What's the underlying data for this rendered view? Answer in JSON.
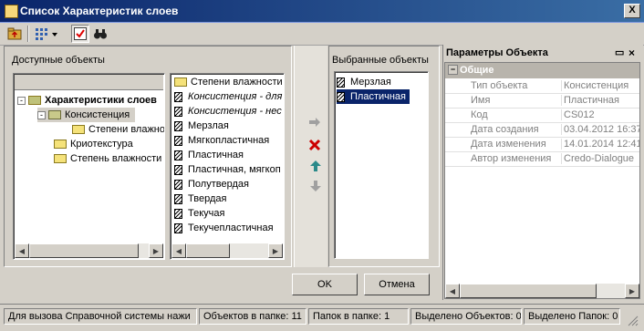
{
  "window": {
    "title": "Список Характеристик слоев",
    "close_label": "X"
  },
  "toolbar": {
    "buttons": [
      "folder-up-icon",
      "view-tree-icon",
      "check-icon",
      "find-icon"
    ]
  },
  "left": {
    "label": "Доступные объекты",
    "tree": [
      {
        "label": "Характеристики слоев",
        "level": 0,
        "bold": true,
        "expander": "-"
      },
      {
        "label": "Консистенция",
        "level": 1,
        "expander": "-"
      },
      {
        "label": "Степени влажнос",
        "level": 2
      },
      {
        "label": "Криотекстура",
        "level": 1
      },
      {
        "label": "Степень влажности",
        "level": 1
      }
    ],
    "list": [
      {
        "label": "Степени влажности",
        "icon": "folder",
        "italic": false
      },
      {
        "label": "Консистенция - для",
        "icon": "hatch",
        "italic": true
      },
      {
        "label": "Консистенция - нес",
        "icon": "hatch",
        "italic": true
      },
      {
        "label": "Мерзлая",
        "icon": "hatch",
        "italic": false
      },
      {
        "label": "Мягкопластичная",
        "icon": "hatch",
        "italic": false
      },
      {
        "label": "Пластичная",
        "icon": "hatch",
        "italic": false
      },
      {
        "label": "Пластичная, мягкоп",
        "icon": "hatch",
        "italic": false
      },
      {
        "label": "Полутвердая",
        "icon": "hatch",
        "italic": false
      },
      {
        "label": "Твердая",
        "icon": "hatch",
        "italic": false
      },
      {
        "label": "Текучая",
        "icon": "hatch",
        "italic": false
      },
      {
        "label": "Текучепластичная",
        "icon": "hatch",
        "italic": false
      }
    ]
  },
  "selected": {
    "label": "Выбранные объекты",
    "items": [
      {
        "label": "Мерзлая",
        "selected": false
      },
      {
        "label": "Пластичная",
        "selected": true
      }
    ]
  },
  "buttons": {
    "ok": "OK",
    "cancel": "Отмена"
  },
  "props": {
    "title": "Параметры Объекта",
    "group": "Общие",
    "rows": [
      {
        "key": "Тип объекта",
        "value": "Консистенция"
      },
      {
        "key": "Имя",
        "value": "Пластичная"
      },
      {
        "key": "Код",
        "value": "CS012"
      },
      {
        "key": "Дата создания",
        "value": "03.04.2012 16:37"
      },
      {
        "key": "Дата изменения",
        "value": "14.01.2014 12:41"
      },
      {
        "key": "Автор изменения",
        "value": "Credo-Dialogue"
      }
    ]
  },
  "status": [
    "Для вызова Справочной системы нажи",
    "Объектов в папке: 11",
    "Папок в папке: 1",
    "Выделено Объектов: 0",
    "Выделено Папок: 0"
  ],
  "colors": {
    "title_start": "#0a246a",
    "title_end": "#3a6ea5",
    "selection": "#0a246a",
    "delete_red": "#cc0000",
    "up_teal": "#2a8a8a"
  }
}
